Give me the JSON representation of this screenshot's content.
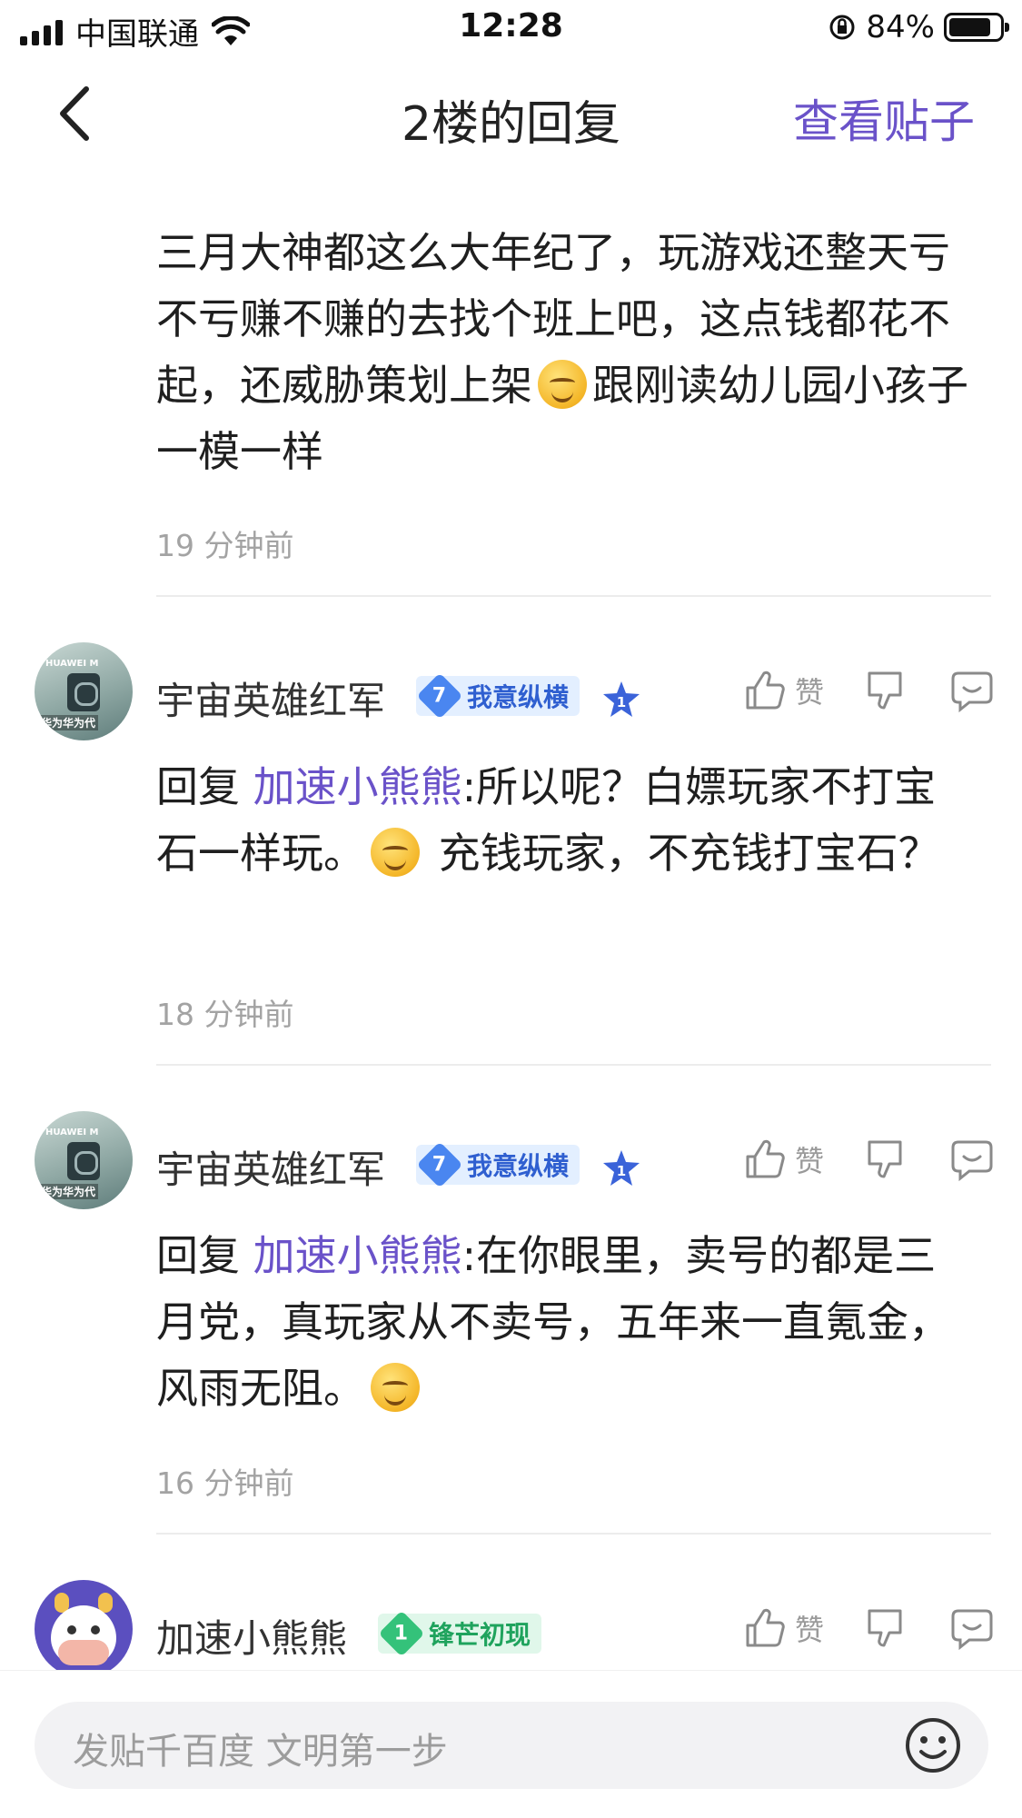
{
  "status_bar": {
    "carrier": "中国联通",
    "time": "12:28",
    "battery": "84%"
  },
  "nav": {
    "title": "2楼的回复",
    "view_post": "查看贴子"
  },
  "replies": [
    {
      "content": "三月大神都这么大年纪了，玩游戏还整天亏不亏赚不赚的去找个班上吧，这点钱都花不起，还威胁策划上架",
      "content_after": "跟刚读幼儿园小孩子一模一样",
      "time": "19 分钟前"
    },
    {
      "username": "宇宙英雄红军",
      "badge_level": "7",
      "badge_text": "我意纵横",
      "like_label": "赞",
      "reply_prefix": "回复 ",
      "mention": "加速小熊熊",
      "content": ":所以呢？白嫖玩家不打宝石一样玩。",
      "content_after": " 充钱玩家，不充钱打宝石？",
      "time": "18 分钟前"
    },
    {
      "username": "宇宙英雄红军",
      "badge_level": "7",
      "badge_text": "我意纵横",
      "like_label": "赞",
      "reply_prefix": "回复 ",
      "mention": "加速小熊熊",
      "content": ":在你眼里，卖号的都是三月党，真玩家从不卖号，五年来一直氪金，风雨无阻。",
      "time": "16 分钟前"
    },
    {
      "username": "加速小熊熊",
      "badge_level": "1",
      "badge_text": "锋芒初现",
      "like_label": "赞"
    }
  ],
  "composer": {
    "placeholder": "发贴千百度 文明第一步"
  },
  "colors": {
    "accent": "#6a52c9",
    "badge_blue": "#4a86f0",
    "badge_green": "#34c27a"
  }
}
